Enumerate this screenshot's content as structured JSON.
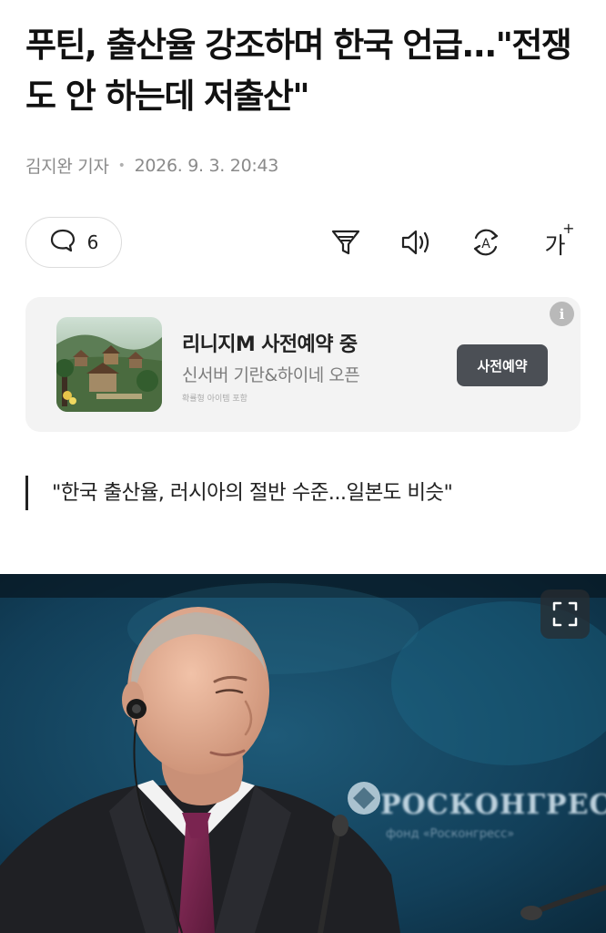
{
  "article": {
    "headline": "푸틴, 출산율 강조하며 한국 언급...\"전쟁도 안 하는데 저출산\"",
    "reporter": "김지완 기자",
    "timestamp": "2026. 9. 3. 20:43",
    "subheading": "\"한국 출산율, 러시아의 절반 수준...일본도 비슷\""
  },
  "toolbar": {
    "comment_count": "6",
    "font_size_label": "가",
    "font_size_plus": "+",
    "translate_letter": "A",
    "icons": [
      "comment-icon",
      "filter-icon",
      "speaker-icon",
      "translate-icon",
      "font-size-icon"
    ]
  },
  "ad": {
    "title": "리니지M 사전예약 중",
    "subtitle": "신서버 기란&하이네 오픈",
    "fine_print": "확률형 아이템 포함",
    "cta": "사전예약",
    "info_label": "i"
  },
  "photo": {
    "backdrop_text": "РОСКОНГРЕСС",
    "backdrop_subtext": "фонд «Росконгресс»",
    "expand_icon": "expand-icon"
  },
  "colors": {
    "text": "#111111",
    "muted": "#8a8a8a",
    "ad_background": "#f3f3f3",
    "cta_background": "#4b4f55"
  }
}
